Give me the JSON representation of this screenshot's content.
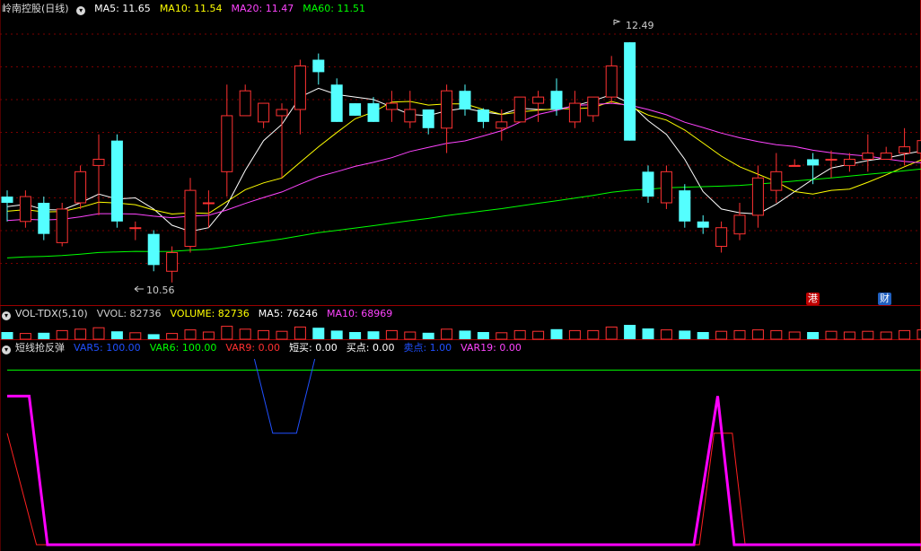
{
  "price_panel": {
    "stock_name": "岭南控股",
    "period": "(日线)",
    "ma_labels": [
      {
        "label": "MA5: 11.65",
        "color": "#ffffff"
      },
      {
        "label": "MA10: 11.54",
        "color": "#ffff00"
      },
      {
        "label": "MA20: 11.47",
        "color": "#ff44ff"
      },
      {
        "label": "MA60: 11.51",
        "color": "#00ff00"
      }
    ],
    "high_label": "12.49",
    "low_label": "10.56",
    "badges": [
      {
        "text": "港",
        "color": "#c00000"
      },
      {
        "text": "财",
        "color": "#2060c0"
      }
    ]
  },
  "volume_panel": {
    "indicator": "VOL-TDX(5,10)",
    "labels": [
      {
        "label": "VVOL: 82736",
        "color": "#cccccc"
      },
      {
        "label": "VOLUME: 82736",
        "color": "#ffff00"
      },
      {
        "label": "MA5: 76246",
        "color": "#ffffff"
      },
      {
        "label": "MA10: 68969",
        "color": "#ff44ff"
      }
    ]
  },
  "signal_panel": {
    "indicator": "短线抢反弹",
    "labels": [
      {
        "label": "VAR5: 100.00",
        "color": "#2050ff"
      },
      {
        "label": "VAR6: 100.00",
        "color": "#00ff00"
      },
      {
        "label": "VAR9: 0.00",
        "color": "#ff3030"
      },
      {
        "label": "短买: 0.00",
        "color": "#ffffff"
      },
      {
        "label": "买点: 0.00",
        "color": "#ffffff"
      },
      {
        "label": "卖点: 1.00",
        "color": "#2050ff"
      },
      {
        "label": "VAR19: 0.00",
        "color": "#ff44ff"
      }
    ]
  },
  "colors": {
    "up": "#ff3232",
    "down": "#54ffff",
    "grid": "#7a0000",
    "ma5": "#ffffff",
    "ma10": "#ffff00",
    "ma20": "#ff44ff",
    "ma60": "#00ff00"
  },
  "chart_data": [
    {
      "type": "candlestick",
      "ylim": [
        10.45,
        12.7
      ],
      "candles": [
        [
          11.25,
          11.2,
          11.3,
          11.05
        ],
        [
          11.05,
          11.25,
          11.3,
          11.0
        ],
        [
          11.2,
          10.95,
          11.25,
          10.9
        ],
        [
          10.88,
          11.15,
          11.2,
          10.85
        ],
        [
          11.2,
          11.45,
          11.5,
          11.15
        ],
        [
          11.5,
          11.55,
          11.75,
          11.1
        ],
        [
          11.7,
          11.05,
          11.75,
          11.0
        ],
        [
          11.0,
          11.0,
          11.05,
          10.9
        ],
        [
          10.95,
          10.7,
          10.98,
          10.65
        ],
        [
          10.65,
          10.8,
          10.85,
          10.56
        ],
        [
          10.85,
          11.3,
          11.4,
          10.8
        ],
        [
          11.2,
          11.2,
          11.3,
          11.0
        ],
        [
          11.45,
          11.9,
          12.15,
          11.25
        ],
        [
          11.9,
          12.1,
          12.15,
          11.9
        ],
        [
          11.85,
          12.0,
          12.0,
          11.8
        ],
        [
          11.9,
          11.95,
          12.0,
          11.4
        ],
        [
          11.95,
          12.3,
          12.35,
          11.75
        ],
        [
          12.35,
          12.25,
          12.4,
          12.15
        ],
        [
          12.15,
          11.85,
          12.2,
          11.85
        ],
        [
          12.0,
          11.9,
          12.0,
          11.9
        ],
        [
          12.0,
          11.85,
          12.05,
          11.85
        ],
        [
          11.95,
          12.0,
          12.1,
          11.85
        ],
        [
          11.85,
          11.95,
          12.1,
          11.8
        ],
        [
          11.95,
          11.8,
          11.95,
          11.75
        ],
        [
          11.8,
          12.1,
          12.15,
          11.6
        ],
        [
          12.1,
          11.95,
          12.15,
          11.9
        ],
        [
          11.95,
          11.85,
          11.96,
          11.8
        ],
        [
          11.8,
          11.85,
          11.95,
          11.7
        ],
        [
          11.85,
          12.05,
          12.05,
          11.85
        ],
        [
          12.0,
          12.05,
          12.1,
          11.85
        ],
        [
          12.1,
          11.95,
          12.2,
          11.9
        ],
        [
          11.85,
          12.0,
          12.1,
          11.8
        ],
        [
          11.9,
          12.05,
          12.05,
          11.85
        ],
        [
          12.05,
          12.3,
          12.38,
          12.0
        ],
        [
          12.49,
          11.7,
          12.49,
          11.7
        ],
        [
          11.45,
          11.25,
          11.5,
          11.2
        ],
        [
          11.2,
          11.45,
          11.5,
          11.15
        ],
        [
          11.3,
          11.05,
          11.35,
          11.0
        ],
        [
          11.05,
          11.0,
          11.1,
          10.95
        ],
        [
          10.85,
          11.0,
          11.05,
          10.8
        ],
        [
          10.95,
          11.1,
          11.2,
          10.9
        ],
        [
          11.1,
          11.4,
          11.5,
          11.0
        ],
        [
          11.3,
          11.45,
          11.6,
          11.2
        ],
        [
          11.5,
          11.5,
          11.55,
          11.5
        ],
        [
          11.55,
          11.5,
          11.6,
          11.35
        ],
        [
          11.55,
          11.55,
          11.62,
          11.4
        ],
        [
          11.5,
          11.55,
          11.6,
          11.45
        ],
        [
          11.55,
          11.6,
          11.75,
          11.45
        ],
        [
          11.55,
          11.6,
          11.65,
          11.55
        ],
        [
          11.6,
          11.65,
          11.8,
          11.5
        ],
        [
          11.6,
          11.7,
          11.8,
          11.55
        ]
      ]
    },
    {
      "type": "bar",
      "values": [
        0.5,
        0.4,
        0.45,
        0.6,
        0.7,
        0.8,
        0.55,
        0.45,
        0.35,
        0.4,
        0.65,
        0.5,
        0.9,
        0.7,
        0.6,
        0.55,
        0.85,
        0.8,
        0.6,
        0.5,
        0.55,
        0.6,
        0.5,
        0.45,
        0.7,
        0.6,
        0.5,
        0.45,
        0.6,
        0.55,
        0.7,
        0.6,
        0.6,
        0.85,
        1.0,
        0.75,
        0.65,
        0.6,
        0.5,
        0.55,
        0.6,
        0.65,
        0.6,
        0.5,
        0.5,
        0.55,
        0.5,
        0.55,
        0.5,
        0.6,
        0.65
      ],
      "ylim": [
        0,
        1
      ]
    },
    {
      "type": "line",
      "ylim": [
        0,
        100
      ],
      "series": [
        {
          "color": "#00ff00",
          "width": 1,
          "points": [
            [
              0,
              94
            ],
            [
              51,
              94
            ]
          ]
        },
        {
          "color": "#2050ff",
          "width": 1,
          "points": [
            [
              13.5,
              100
            ],
            [
              14.5,
              60
            ],
            [
              15.8,
              60
            ],
            [
              16.8,
              100
            ]
          ]
        },
        {
          "color": "#ff2020",
          "width": 1,
          "points": [
            [
              0,
              60
            ],
            [
              1.6,
              0
            ],
            [
              37.8,
              0
            ],
            [
              38.6,
              60
            ],
            [
              39.6,
              60
            ],
            [
              40.3,
              0
            ],
            [
              51,
              0
            ]
          ]
        },
        {
          "color": "#ff00ff",
          "width": 3,
          "points": [
            [
              0,
              80
            ],
            [
              1.2,
              80
            ],
            [
              2.2,
              0
            ],
            [
              37.5,
              0
            ],
            [
              38.8,
              80
            ],
            [
              39.7,
              0
            ],
            [
              51,
              0
            ]
          ]
        }
      ]
    }
  ]
}
